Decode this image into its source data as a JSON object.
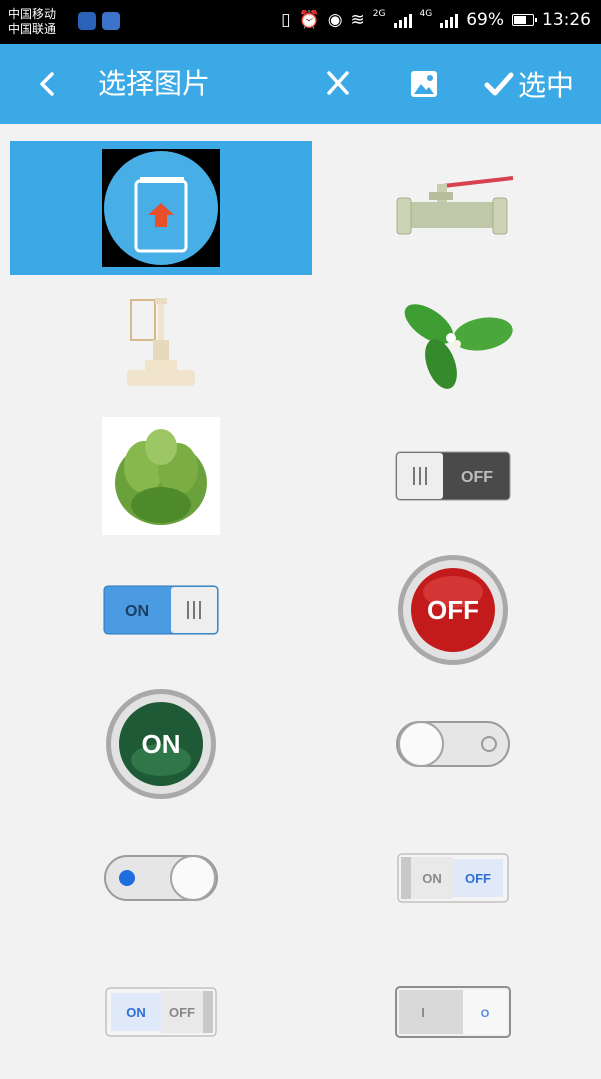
{
  "status_bar": {
    "carrier_1": "中国移动",
    "carrier_2": "中国联通",
    "network_1": "2G",
    "network_2": "4G",
    "battery": "69%",
    "time": "13:26"
  },
  "header": {
    "title": "选择图片",
    "select_label": "选中",
    "background": "#3aa9e6"
  },
  "images": [
    {
      "name": "upload",
      "selected": true
    },
    {
      "name": "ball-valve",
      "selected": false
    },
    {
      "name": "gate-valve",
      "selected": false
    },
    {
      "name": "leaves",
      "selected": false
    },
    {
      "name": "lettuce",
      "selected": false
    },
    {
      "name": "switch-off-dark",
      "selected": false,
      "label": "OFF"
    },
    {
      "name": "switch-on-blue",
      "selected": false,
      "label": "ON"
    },
    {
      "name": "red-off-button",
      "selected": false,
      "label": "OFF"
    },
    {
      "name": "green-on-button",
      "selected": false,
      "label": "ON"
    },
    {
      "name": "toggle-grey",
      "selected": false
    },
    {
      "name": "toggle-blue-dot",
      "selected": false
    },
    {
      "name": "rocker-on-off-1",
      "selected": false,
      "on_label": "ON",
      "off_label": "OFF"
    },
    {
      "name": "rocker-on-off-2",
      "selected": false,
      "on_label": "ON",
      "off_label": "OFF"
    },
    {
      "name": "rocker-i-o",
      "selected": false,
      "on_label": "I",
      "off_label": "O"
    }
  ]
}
